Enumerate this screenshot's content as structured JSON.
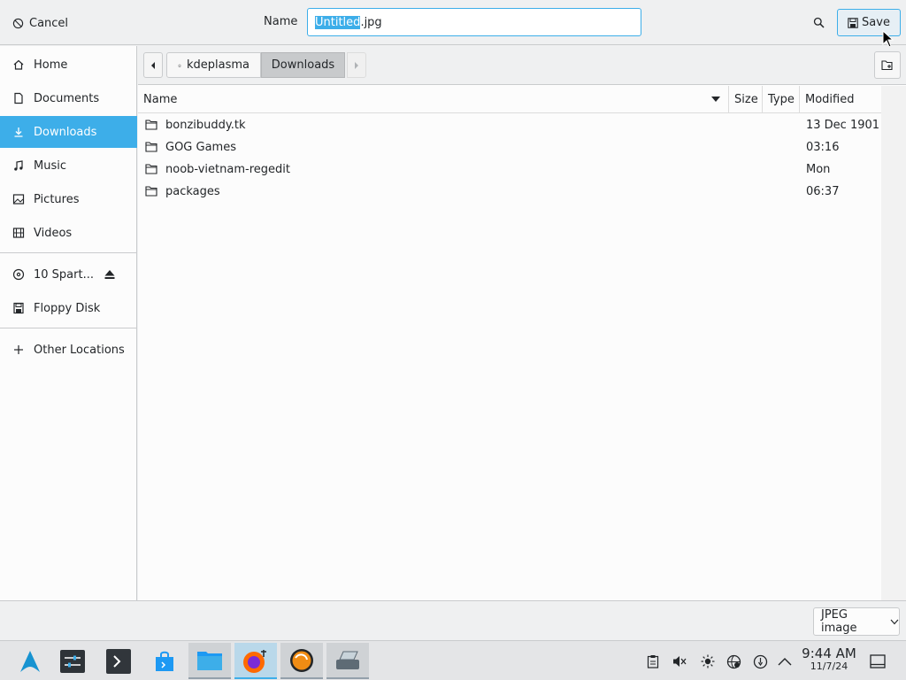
{
  "header": {
    "cancel_label": "Cancel",
    "name_label": "Name",
    "filename_selected": "Untitled",
    "filename_ext": ".jpg",
    "save_label": "Save"
  },
  "sidebar": {
    "items": [
      {
        "label": "Home",
        "icon": "home-icon"
      },
      {
        "label": "Documents",
        "icon": "document-icon"
      },
      {
        "label": "Downloads",
        "icon": "download-icon",
        "active": true
      },
      {
        "label": "Music",
        "icon": "music-icon"
      },
      {
        "label": "Pictures",
        "icon": "picture-icon"
      },
      {
        "label": "Videos",
        "icon": "video-icon"
      }
    ],
    "devices": [
      {
        "label": "10 Spart...",
        "icon": "optical-disc-icon"
      },
      {
        "label": "Floppy Disk",
        "icon": "floppy-icon"
      }
    ],
    "other_locations": "Other Locations"
  },
  "pathbar": {
    "home_crumb": "kdeplasma",
    "current_crumb": "Downloads"
  },
  "columns": {
    "name": "Name",
    "size": "Size",
    "type": "Type",
    "modified": "Modified"
  },
  "files": [
    {
      "name": "bonzibuddy.tk",
      "modified": "13 Dec 1901"
    },
    {
      "name": "GOG Games",
      "modified": "03:16"
    },
    {
      "name": "noob-vietnam-regedit",
      "modified": "Mon"
    },
    {
      "name": "packages",
      "modified": "06:37"
    }
  ],
  "filter": {
    "selected": "JPEG image"
  },
  "taskbar": {
    "time": "9:44 AM",
    "date": "11/7/24"
  },
  "colors": {
    "accent": "#3daee9",
    "window_bg": "#eff0f1",
    "view_bg": "#fcfcfc"
  }
}
